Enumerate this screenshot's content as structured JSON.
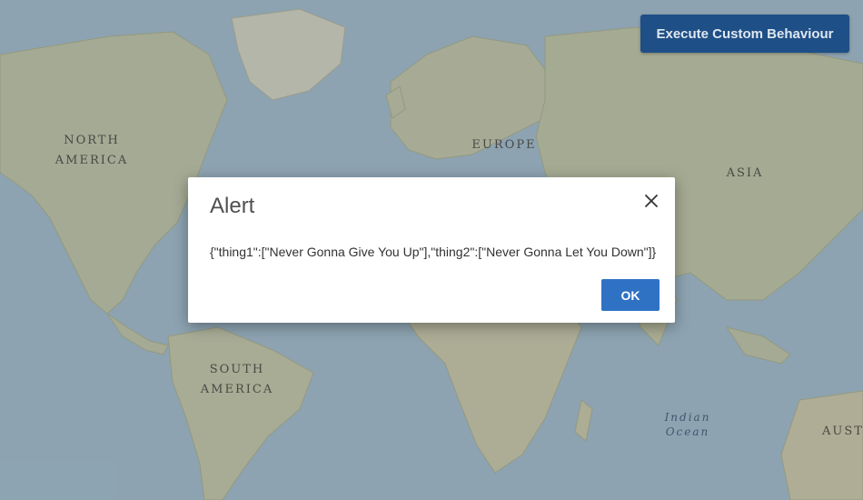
{
  "map": {
    "continent_labels": {
      "north_america": "NORTH\nAMERICA",
      "europe": "EUROPE",
      "asia": "ASIA",
      "south_america": "SOUTH\nAMERICA",
      "australia": "AUST"
    },
    "ocean_labels": {
      "indian": "Indian\nOcean"
    },
    "colors": {
      "ocean": "#aac9dd",
      "land": "#c9d1b3",
      "land_light": "#d9dcc4"
    }
  },
  "toolbar": {
    "execute_label": "Execute Custom Behaviour"
  },
  "alert": {
    "title": "Alert",
    "message": "{\"thing1\":[\"Never Gonna Give You Up\"],\"thing2\":[\"Never Gonna Let You Down\"]}",
    "ok_label": "OK",
    "close_icon": "close-icon"
  }
}
